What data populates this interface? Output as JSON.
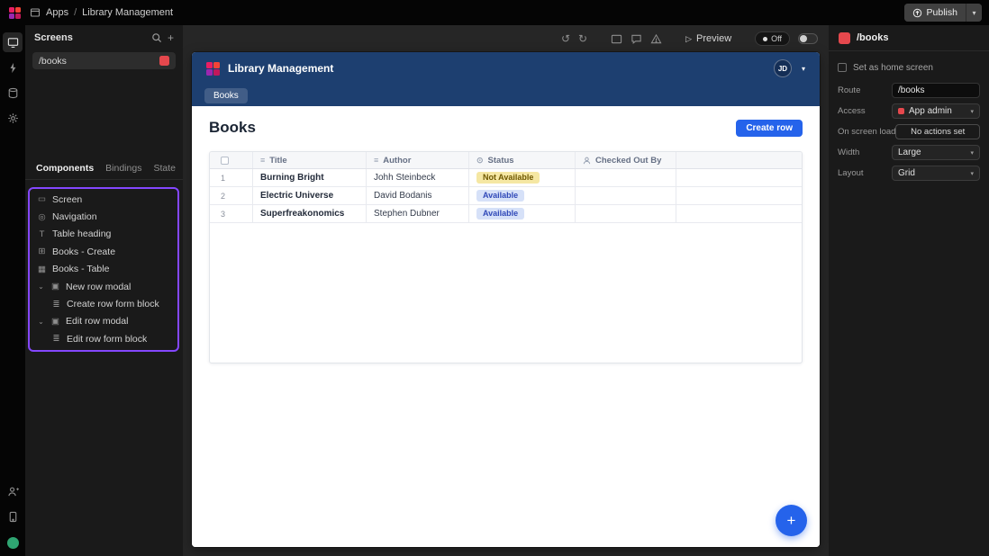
{
  "topbar": {
    "breadcrumb": {
      "apps": "Apps",
      "separator": "/",
      "app_name": "Library Management"
    },
    "publish": {
      "label": "Publish"
    }
  },
  "screens_panel": {
    "title": "Screens",
    "screens": [
      {
        "route": "/books"
      }
    ],
    "tabs": [
      {
        "label": "Components"
      },
      {
        "label": "Bindings"
      },
      {
        "label": "State"
      }
    ],
    "component_tree": [
      {
        "label": "Screen"
      },
      {
        "label": "Navigation"
      },
      {
        "label": "Table heading"
      },
      {
        "label": "Books - Create"
      },
      {
        "label": "Books - Table"
      },
      {
        "label": "New row modal"
      },
      {
        "label": "Create row form block"
      },
      {
        "label": "Edit row modal"
      },
      {
        "label": "Edit row form block"
      }
    ]
  },
  "canvas_toolbar": {
    "preview_label": "Preview",
    "off_label": "Off"
  },
  "app_preview": {
    "header": {
      "title": "Library Management",
      "avatar_initials": "JD"
    },
    "nav": {
      "tabs": [
        {
          "label": "Books"
        }
      ]
    },
    "page": {
      "title": "Books",
      "create_row_label": "Create row"
    },
    "table": {
      "columns": [
        {
          "label": "Title"
        },
        {
          "label": "Author"
        },
        {
          "label": "Status"
        },
        {
          "label": "Checked Out By"
        }
      ],
      "rows": [
        {
          "num": "1",
          "title": "Burning Bright",
          "author": "Johh Steinbeck",
          "status": "Not Available",
          "status_variant": "warning"
        },
        {
          "num": "2",
          "title": "Electric Universe",
          "author": "David Bodanis",
          "status": "Available",
          "status_variant": "info"
        },
        {
          "num": "3",
          "title": "Superfreakonomics",
          "author": "Stephen Dubner",
          "status": "Available",
          "status_variant": "info"
        }
      ]
    }
  },
  "right_panel": {
    "title": "/books",
    "home_screen_label": "Set as home screen",
    "route": {
      "label": "Route",
      "value": "/books"
    },
    "access": {
      "label": "Access",
      "value": "App admin"
    },
    "on_screen_load": {
      "label": "On screen load",
      "value": "No actions set"
    },
    "width": {
      "label": "Width",
      "value": "Large"
    },
    "layout": {
      "label": "Layout",
      "value": "Grid"
    }
  },
  "icons": {
    "window": "▭",
    "eye": "◎",
    "text": "T",
    "form_create": "⊞",
    "table": "▦",
    "modal": "▣",
    "form_block": "≣",
    "chevron_down": "▾",
    "chevron_expand": "⌄",
    "plus": "+",
    "play": "▷",
    "undo": "↺",
    "redo": "↻",
    "lines": "≡",
    "select": "⊙"
  },
  "colors": {
    "accent_purple": "#8447ff",
    "accent_blue": "#2563eb",
    "accent_red": "#e5484d",
    "app_header_navy": "#1d3f70"
  }
}
